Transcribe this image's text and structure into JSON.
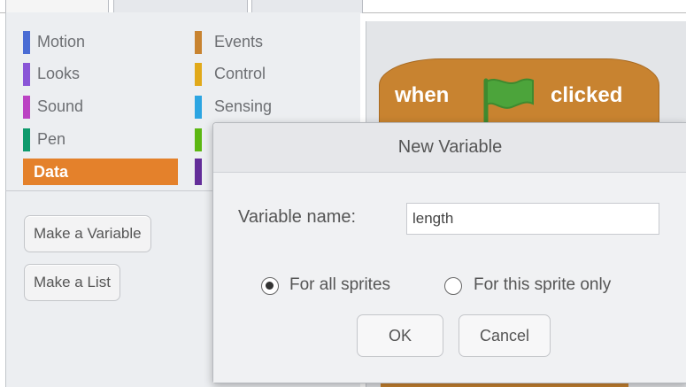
{
  "palette": {
    "categories_left": [
      {
        "label": "Motion",
        "color": "#4a6cd4"
      },
      {
        "label": "Looks",
        "color": "#8a55d7"
      },
      {
        "label": "Sound",
        "color": "#bb42c3"
      },
      {
        "label": "Pen",
        "color": "#0e9a6c"
      },
      {
        "label": "Data",
        "color": "#ee7d16",
        "selected": true
      }
    ],
    "categories_right": [
      {
        "label": "Events",
        "color": "#c88330"
      },
      {
        "label": "Control",
        "color": "#e1a91a"
      },
      {
        "label": "Sensing",
        "color": "#2ca5e2"
      },
      {
        "label": "",
        "color": "#5cb712"
      },
      {
        "label": "",
        "color": "#632d99"
      }
    ],
    "make_variable_label": "Make a Variable",
    "make_list_label": "Make a List"
  },
  "script": {
    "hat_when": "when",
    "hat_clicked": "clicked",
    "flag_color": "#4ca43b"
  },
  "dialog": {
    "title": "New Variable",
    "name_label": "Variable name:",
    "name_value": "length",
    "scope_options": [
      {
        "label": "For all sprites",
        "selected": true
      },
      {
        "label": "For this sprite only",
        "selected": false
      }
    ],
    "ok_label": "OK",
    "cancel_label": "Cancel"
  }
}
